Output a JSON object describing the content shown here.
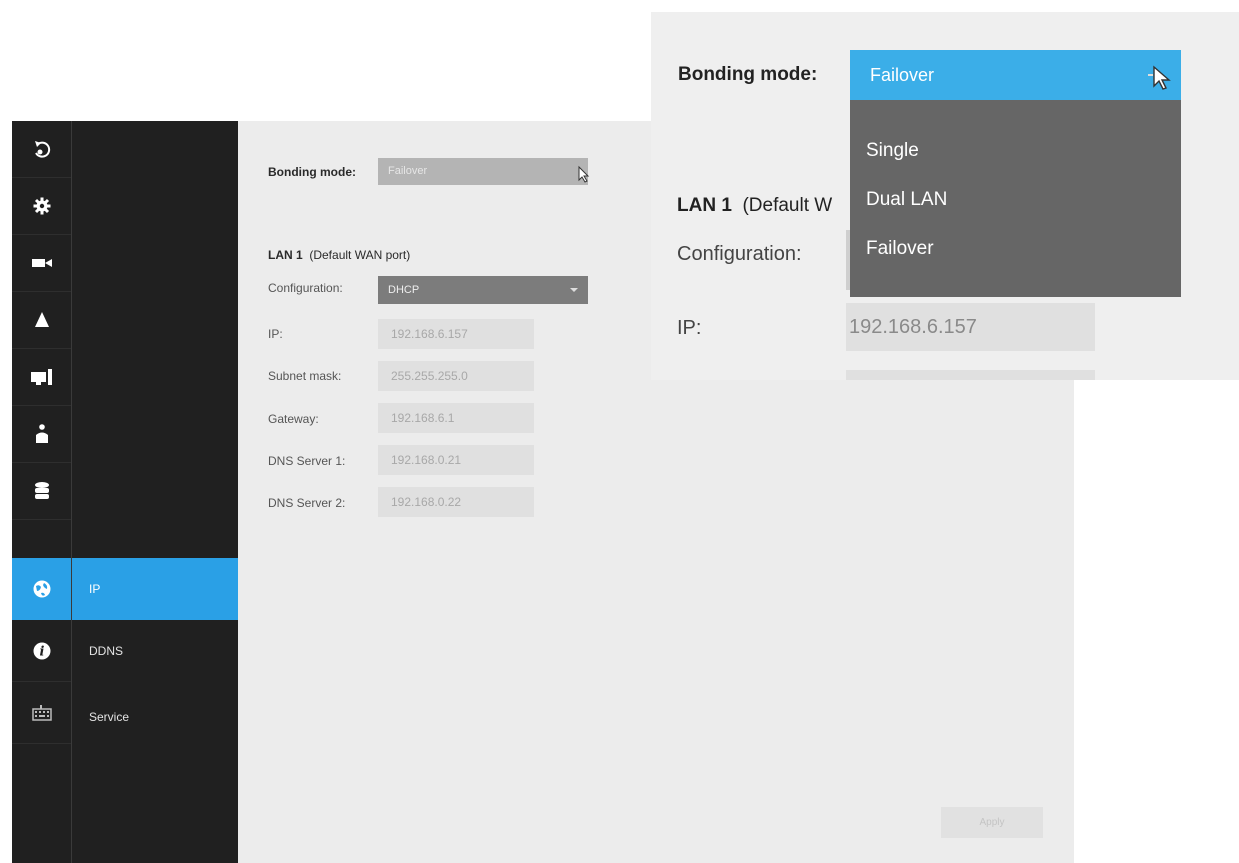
{
  "sidebar": {
    "icons": [
      {
        "name": "playback-icon"
      },
      {
        "name": "gear-icon"
      },
      {
        "name": "camera-icon"
      },
      {
        "name": "alarm-icon"
      },
      {
        "name": "monitor-icon"
      },
      {
        "name": "user-icon"
      },
      {
        "name": "storage-icon"
      },
      {
        "name": "network-globe-icon",
        "active": true
      },
      {
        "name": "info-icon"
      },
      {
        "name": "keyboard-icon"
      }
    ],
    "subnav": [
      {
        "label": "IP",
        "active": true
      },
      {
        "label": "DDNS"
      },
      {
        "label": "Service"
      }
    ]
  },
  "main": {
    "bonding_label": "Bonding mode:",
    "bonding_value": "Failover",
    "lan_title_bold": "LAN 1",
    "lan_title_rest": "(Default WAN port)",
    "configuration_label": "Configuration:",
    "configuration_value": "DHCP",
    "fields": [
      {
        "label": "IP:",
        "value": "192.168.6.157"
      },
      {
        "label": "Subnet mask:",
        "value": "255.255.255.0"
      },
      {
        "label": "Gateway:",
        "value": "192.168.6.1"
      },
      {
        "label": "DNS Server 1:",
        "value": "192.168.0.21"
      },
      {
        "label": "DNS Server 2:",
        "value": "192.168.0.22"
      }
    ],
    "apply_label": "Apply"
  },
  "zoom": {
    "bonding_label": "Bonding mode:",
    "bonding_value": "Failover",
    "options": [
      "Single",
      "Dual LAN",
      "Failover"
    ],
    "lan_title_bold": "LAN 1",
    "lan_title_rest": "(Default W",
    "configuration_label": "Configuration:",
    "ip_label": "IP:",
    "ip_value": "192.168.6.157"
  },
  "colors": {
    "accent": "#2aa0e6",
    "sidebar_bg": "#202020",
    "content_bg": "#ececec",
    "dropdown_bg": "#666666"
  }
}
